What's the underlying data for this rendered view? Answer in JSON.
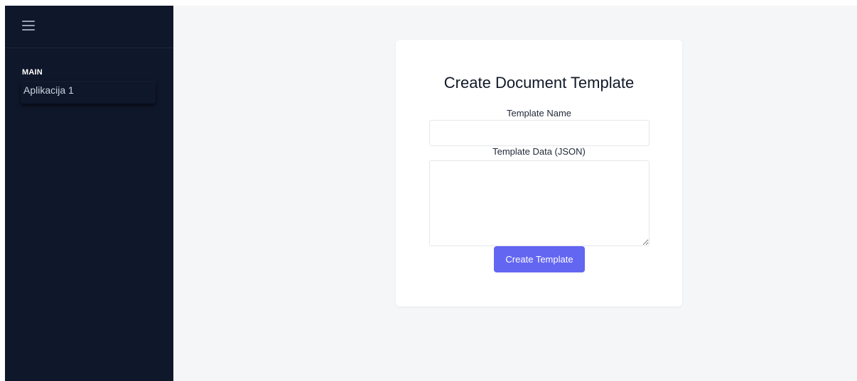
{
  "sidebar": {
    "menu_icon": "hamburger-menu-icon",
    "section_title": "MAIN",
    "items": [
      {
        "label": "Aplikacija 1"
      }
    ]
  },
  "form": {
    "title": "Create Document Template",
    "name_label": "Template Name",
    "name_value": "",
    "name_placeholder": "",
    "data_label": "Template Data (JSON)",
    "data_value": "",
    "data_placeholder": "",
    "submit_label": "Create Template"
  },
  "colors": {
    "sidebar_bg": "#0f172a",
    "main_bg": "#f5f6f8",
    "accent": "#6366f1",
    "card_bg": "#ffffff"
  }
}
